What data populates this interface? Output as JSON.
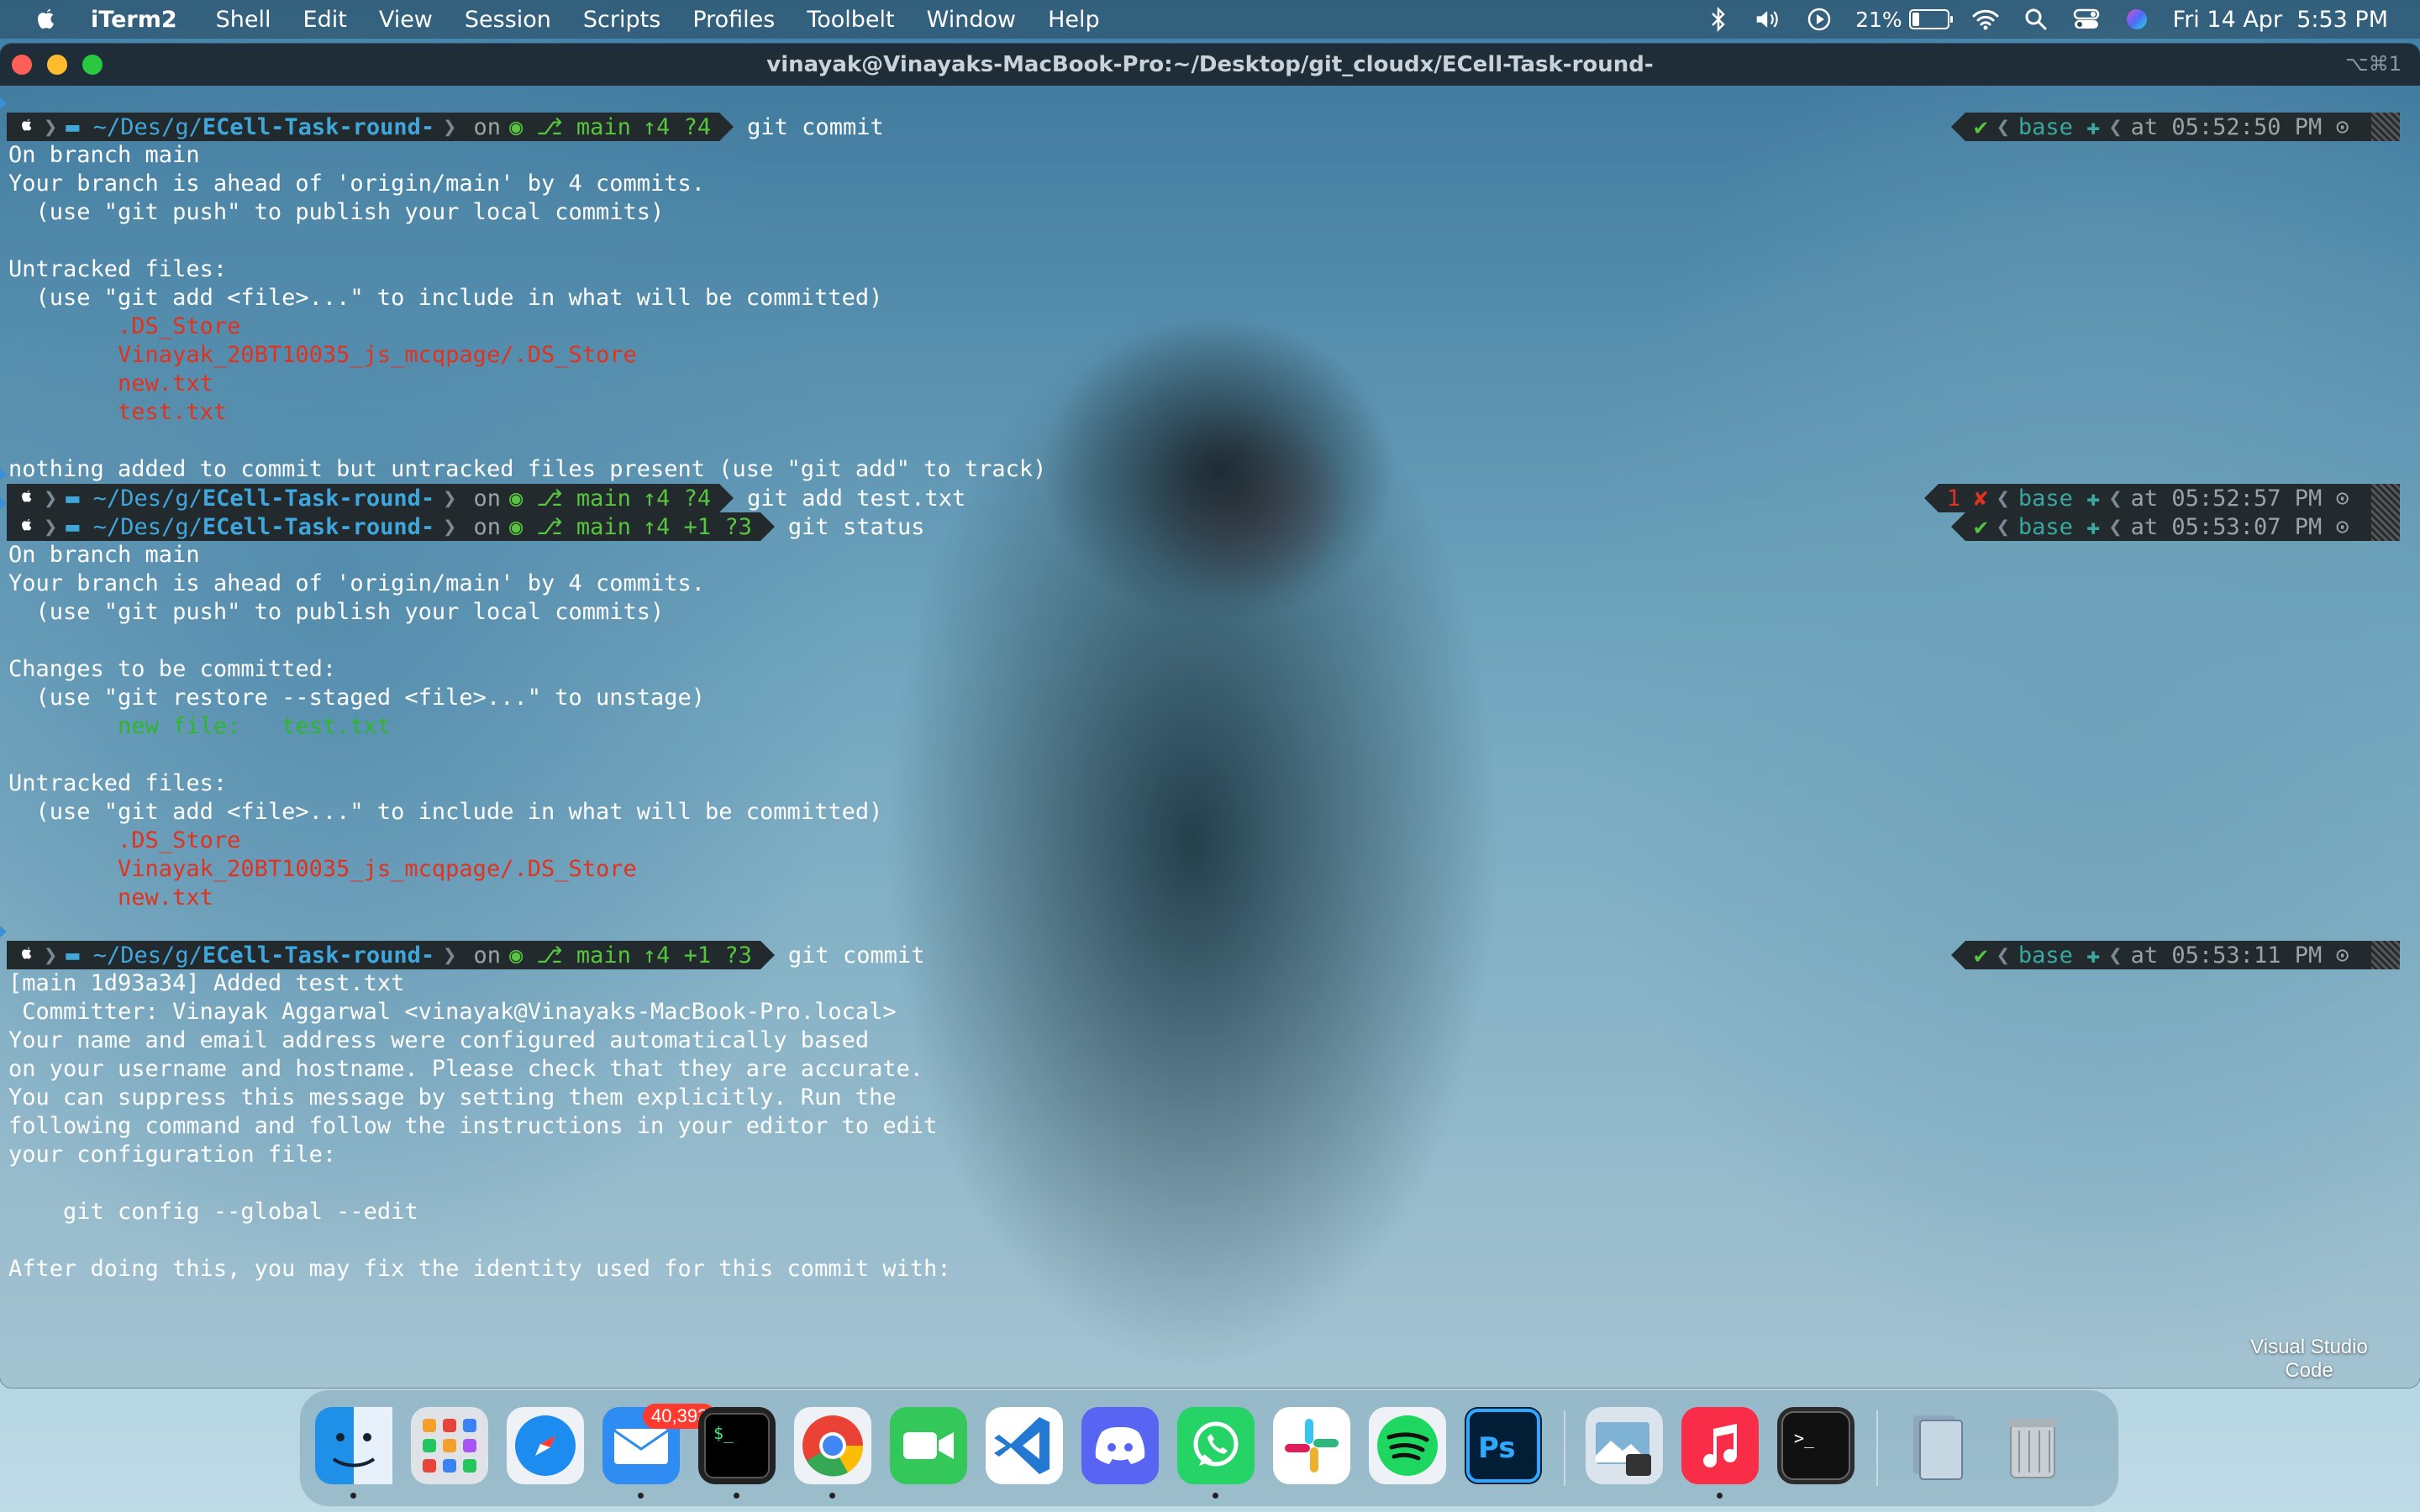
{
  "menubar": {
    "app": "iTerm2",
    "items": [
      "Shell",
      "Edit",
      "View",
      "Session",
      "Scripts",
      "Profiles",
      "Toolbelt",
      "Window",
      "Help"
    ],
    "battery": "21%",
    "battery_level": 0.21,
    "datetime": "Fri 14 Apr  5:53 PM",
    "icons": [
      "apple-icon",
      "bluetooth-icon",
      "volume-icon",
      "play-icon",
      "battery-icon",
      "wifi-icon",
      "search-icon",
      "control-center-icon",
      "siri-icon"
    ]
  },
  "window": {
    "title": "vinayak@Vinayaks-MacBook-Pro:~/Desktop/git_cloudx/ECell-Task-round-",
    "shortcut": "⌥⌘1"
  },
  "prompt": {
    "path_dim": "~/Des/g/",
    "path_bold": "ECell-Task-round-",
    "on": "on",
    "branch": "main"
  },
  "blocks": [
    {
      "status": "↑4 ?4",
      "command": "git commit",
      "rstatus": "✔",
      "env": "base",
      "time": "at 05:52:50 PM",
      "output": [
        {
          "t": "On branch main",
          "c": "white"
        },
        {
          "t": "Your branch is ahead of 'origin/main' by 4 commits.",
          "c": "white"
        },
        {
          "t": "  (use \"git push\" to publish your local commits)",
          "c": "white"
        },
        {
          "t": "",
          "c": "white"
        },
        {
          "t": "Untracked files:",
          "c": "white"
        },
        {
          "t": "  (use \"git add <file>...\" to include in what will be committed)",
          "c": "white"
        },
        {
          "t": "        .DS_Store",
          "c": "red"
        },
        {
          "t": "        Vinayak_20BT10035_js_mcqpage/.DS_Store",
          "c": "red"
        },
        {
          "t": "        new.txt",
          "c": "red"
        },
        {
          "t": "        test.txt",
          "c": "red"
        },
        {
          "t": "",
          "c": "white"
        },
        {
          "t": "nothing added to commit but untracked files present (use \"git add\" to track)",
          "c": "white"
        }
      ]
    },
    {
      "status": "↑4 ?4",
      "command": "git add test.txt",
      "rstatus": "1 ✘",
      "env": "base",
      "time": "at 05:52:57 PM",
      "output": []
    },
    {
      "status": "↑4 +1 ?3",
      "command": "git status",
      "rstatus": "✔",
      "env": "base",
      "time": "at 05:53:07 PM",
      "output": [
        {
          "t": "On branch main",
          "c": "white"
        },
        {
          "t": "Your branch is ahead of 'origin/main' by 4 commits.",
          "c": "white"
        },
        {
          "t": "  (use \"git push\" to publish your local commits)",
          "c": "white"
        },
        {
          "t": "",
          "c": "white"
        },
        {
          "t": "Changes to be committed:",
          "c": "white"
        },
        {
          "t": "  (use \"git restore --staged <file>...\" to unstage)",
          "c": "white"
        },
        {
          "t": "        new file:   test.txt",
          "c": "green"
        },
        {
          "t": "",
          "c": "white"
        },
        {
          "t": "Untracked files:",
          "c": "white"
        },
        {
          "t": "  (use \"git add <file>...\" to include in what will be committed)",
          "c": "white"
        },
        {
          "t": "        .DS_Store",
          "c": "red"
        },
        {
          "t": "        Vinayak_20BT10035_js_mcqpage/.DS_Store",
          "c": "red"
        },
        {
          "t": "        new.txt",
          "c": "red"
        },
        {
          "t": "",
          "c": "white"
        }
      ]
    },
    {
      "status": "↑4 +1 ?3",
      "command": "git commit",
      "rstatus": "✔",
      "env": "base",
      "time": "at 05:53:11 PM",
      "output": [
        {
          "t": "[main 1d93a34] Added test.txt",
          "c": "white"
        },
        {
          "t": " Committer: Vinayak Aggarwal <vinayak@Vinayaks-MacBook-Pro.local>",
          "c": "white"
        },
        {
          "t": "Your name and email address were configured automatically based",
          "c": "white"
        },
        {
          "t": "on your username and hostname. Please check that they are accurate.",
          "c": "white"
        },
        {
          "t": "You can suppress this message by setting them explicitly. Run the",
          "c": "white"
        },
        {
          "t": "following command and follow the instructions in your editor to edit",
          "c": "white"
        },
        {
          "t": "your configuration file:",
          "c": "white"
        },
        {
          "t": "",
          "c": "white"
        },
        {
          "t": "    git config --global --edit",
          "c": "white"
        },
        {
          "t": "",
          "c": "white"
        },
        {
          "t": "After doing this, you may fix the identity used for this commit with:",
          "c": "white"
        }
      ]
    }
  ],
  "dock": {
    "apps": [
      {
        "name": "finder",
        "running": true
      },
      {
        "name": "launchpad",
        "running": false
      },
      {
        "name": "safari",
        "running": false
      },
      {
        "name": "mail",
        "running": true,
        "badge": "40,393"
      },
      {
        "name": "iterm",
        "running": true
      },
      {
        "name": "chrome",
        "running": true
      },
      {
        "name": "facetime",
        "running": false
      },
      {
        "name": "vscode",
        "running": false
      },
      {
        "name": "discord",
        "running": false
      },
      {
        "name": "whatsapp",
        "running": true
      },
      {
        "name": "slack",
        "running": false
      },
      {
        "name": "spotify",
        "running": false
      },
      {
        "name": "photoshop",
        "running": false
      },
      {
        "name": "preview",
        "running": false
      },
      {
        "name": "music",
        "running": true
      },
      {
        "name": "terminal",
        "running": false
      },
      {
        "name": "documents",
        "running": false
      },
      {
        "name": "trash",
        "running": false
      }
    ]
  },
  "desktop_item_label": "Visual Studio Code"
}
